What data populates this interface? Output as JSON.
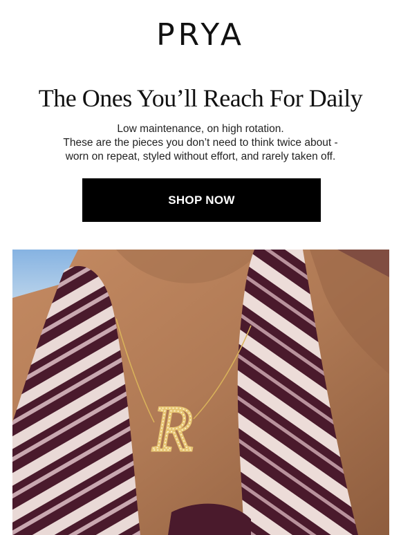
{
  "brand": {
    "logo_text": "PRYA"
  },
  "hero_section": {
    "headline": "The Ones You’ll Reach For Daily",
    "body_lines": [
      "Low maintenance, on high rotation.",
      "These are the pieces you don’t need to think twice about -",
      "worn on repeat, styled without effort, and rarely taken off."
    ],
    "cta_label": "SHOP NOW"
  },
  "hero_image": {
    "pendant_letter": "R"
  },
  "colors": {
    "text": "#111111",
    "cta_background": "#000000",
    "cta_text": "#ffffff",
    "skin": "#b07a55",
    "scarf": "#4a1a2c",
    "sky": "#8fb8e0",
    "gold": "#d9b25a"
  }
}
